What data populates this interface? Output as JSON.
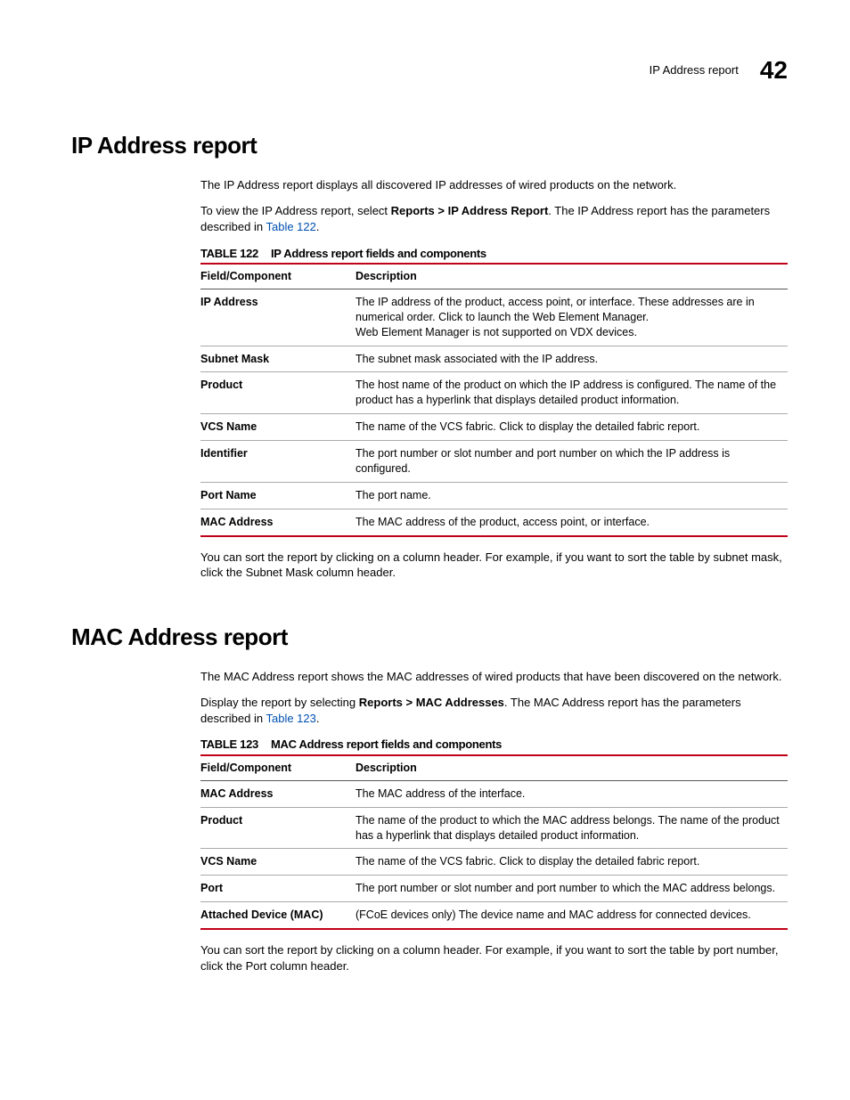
{
  "header": {
    "label": "IP Address report",
    "page": "42"
  },
  "s1": {
    "title": "IP Address report",
    "p1": "The IP Address report displays all discovered IP addresses of wired products on the network.",
    "p2a": "To view the IP Address report, select ",
    "p2b": "Reports > IP Address Report",
    "p2c": ". The IP Address report has the parameters described in ",
    "p2link": "Table 122",
    "p2d": ".",
    "tnum": "TABLE 122",
    "ttitle": "IP Address report fields and components",
    "th1": "Field/Component",
    "th2": "Description",
    "rows": [
      {
        "f": "IP Address",
        "d": "The IP address of the product, access point, or interface. These addresses are in numerical order. Click to launch the Web Element Manager.\nWeb Element Manager is not supported on VDX devices."
      },
      {
        "f": "Subnet Mask",
        "d": "The subnet mask associated with the IP address."
      },
      {
        "f": "Product",
        "d": "The host name of the product on which the IP address is configured. The name of the product has a hyperlink that displays detailed product information."
      },
      {
        "f": "VCS Name",
        "d": "The name of the VCS fabric. Click to display the detailed fabric report."
      },
      {
        "f": "Identifier",
        "d": "The port number or slot number and port number on which the IP address is configured."
      },
      {
        "f": "Port Name",
        "d": "The port name."
      },
      {
        "f": "MAC Address",
        "d": "The MAC address of the product, access point, or interface."
      }
    ],
    "p3": "You can sort the report by clicking on a column header. For example, if you want to sort the table by subnet mask, click the Subnet Mask column header."
  },
  "s2": {
    "title": "MAC Address report",
    "p1": "The MAC Address report shows the MAC addresses of wired products that have been discovered on the network.",
    "p2a": "Display the report by selecting ",
    "p2b": "Reports > MAC Addresses",
    "p2c": ". The MAC Address report has the parameters described in ",
    "p2link": "Table 123",
    "p2d": ".",
    "tnum": "TABLE 123",
    "ttitle": "MAC Address report fields and components",
    "th1": "Field/Component",
    "th2": "Description",
    "rows": [
      {
        "f": "MAC Address",
        "d": "The MAC address of the interface."
      },
      {
        "f": "Product",
        "d": "The name of the product to which the MAC address belongs. The name of the product has a hyperlink that displays detailed product information."
      },
      {
        "f": "VCS Name",
        "d": "The name of the VCS fabric. Click to display the detailed fabric report."
      },
      {
        "f": "Port",
        "d": "The port number or slot number and port number to which the MAC address belongs."
      },
      {
        "f": "Attached Device (MAC)",
        "d": "(FCoE devices only) The device name and MAC address for connected devices."
      }
    ],
    "p3": "You can sort the report by clicking on a column header. For example, if you want to sort the table by port number, click the Port column header."
  }
}
